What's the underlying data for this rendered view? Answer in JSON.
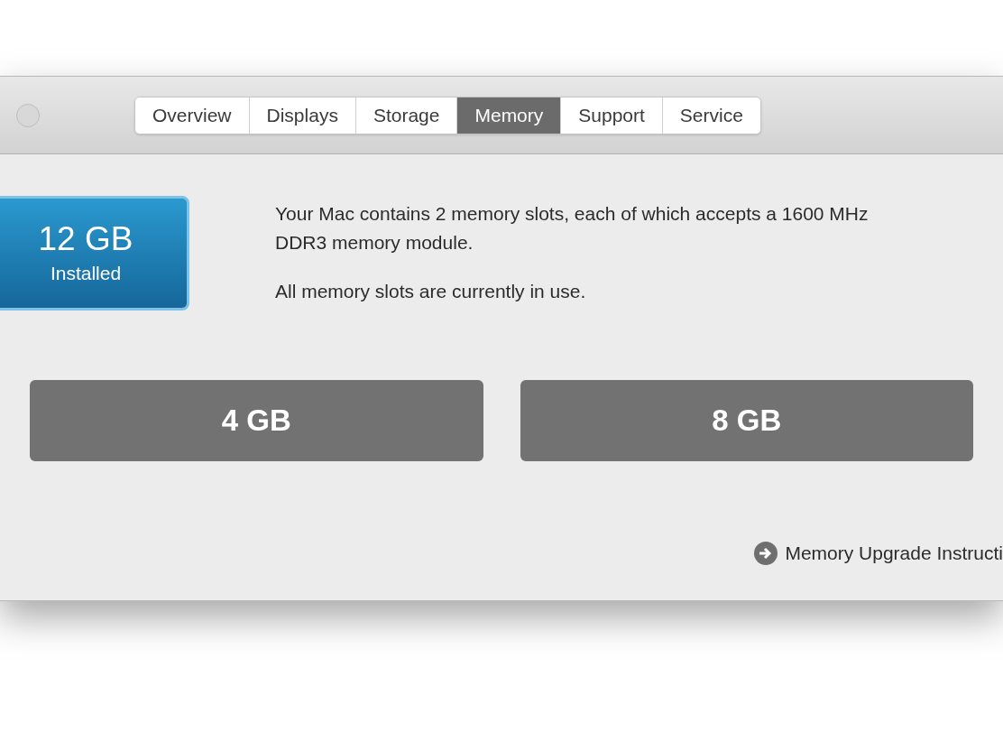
{
  "tabs": [
    {
      "label": "Overview",
      "selected": false
    },
    {
      "label": "Displays",
      "selected": false
    },
    {
      "label": "Storage",
      "selected": false
    },
    {
      "label": "Memory",
      "selected": true
    },
    {
      "label": "Support",
      "selected": false
    },
    {
      "label": "Service",
      "selected": false
    }
  ],
  "installed": {
    "amount": "12 GB",
    "label": "Installed"
  },
  "description": [
    "Your Mac contains 2 memory slots, each of which accepts a 1600 MHz DDR3 memory module.",
    "All memory slots are currently in use."
  ],
  "slots": [
    {
      "size": "4 GB"
    },
    {
      "size": "8 GB"
    }
  ],
  "link": "Memory Upgrade Instructi"
}
